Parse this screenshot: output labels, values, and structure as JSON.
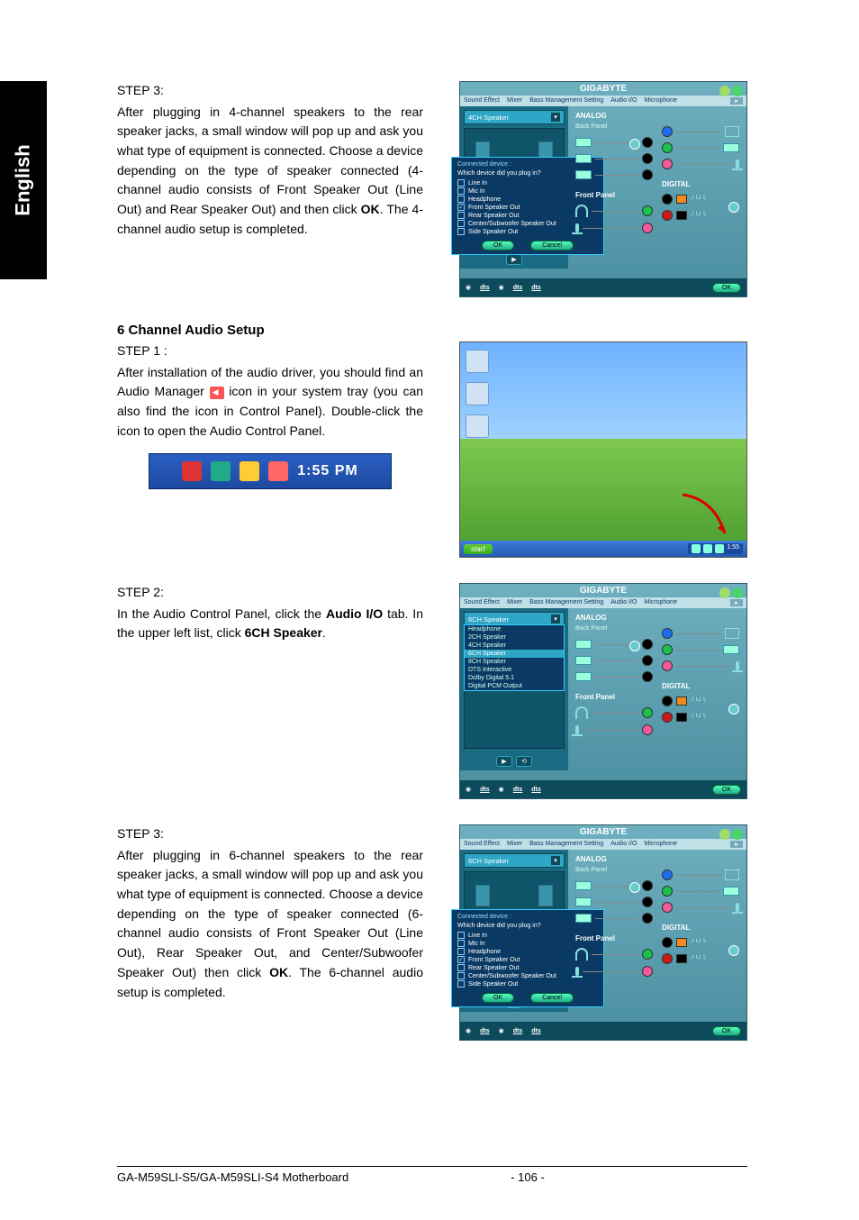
{
  "language_tab": "English",
  "section3a": {
    "step": "STEP 3:",
    "body_a": "After plugging in 4-channel speakers to the rear speaker jacks, a small window will pop up and ask you what type of equipment is connected. Choose a device depending on the type of speaker connected (4-channel audio consists of Front Speaker Out (Line Out) and Rear Speaker Out) and then click ",
    "ok": "OK",
    "body_b": ". The 4-channel audio setup is completed."
  },
  "heading6": "6 Channel Audio Setup",
  "section1b": {
    "step": "STEP 1 :",
    "body_a": "After installation of the audio driver, you should find an Audio Manager",
    "body_b": " icon in your system tray (you can also find the icon in Control Panel).  Double-click the icon to open the Audio Control Panel."
  },
  "tray_time": "1:55 PM",
  "start_label": "start",
  "section2b": {
    "step": "STEP 2:",
    "body_a": "In the Audio Control Panel, click the ",
    "audioio": "Audio I/O",
    "body_b": " tab. In the upper left list, click ",
    "sixch": "6CH Speaker",
    "body_c": "."
  },
  "section3b": {
    "step": "STEP 3:",
    "body_a": "After plugging in 6-channel speakers to the rear speaker jacks, a small window will pop up and ask you what type of equipment is connected. Choose a device depending on the type of speaker connected (6-channel audio consists of Front Speaker Out (Line Out), Rear Speaker Out, and Center/Subwoofer Speaker Out) then click ",
    "ok": "OK",
    "body_b": ". The 6-channel audio setup is completed."
  },
  "panel": {
    "brand": "GIGABYTE",
    "tabs": [
      "Sound Effect",
      "Mixer",
      "Bass Management Setting",
      "Audio I/O",
      "Microphone"
    ],
    "analog": "ANALOG",
    "backpanel": "Back Panel",
    "frontpanel": "Front Panel",
    "digital": "DIGITAL",
    "ok": "OK",
    "dts": "dts",
    "drop_4ch": "4CH Speaker",
    "drop_6ch": "6CH Speaker",
    "droplist": [
      "Headphone",
      "2CH Speaker",
      "4CH Speaker",
      "6CH Speaker",
      "8CH Speaker",
      "DTS Interactive",
      "Dolby Digital 5.1",
      "Digital PCM Output"
    ]
  },
  "popup": {
    "hdr": "Connected device :",
    "q": "Which device did you plug in?",
    "opts": [
      "Line In",
      "Mic In",
      "Headphone",
      "Front Speaker Out",
      "Rear Speaker Out",
      "Center/Subwoofer Speaker Out",
      "Side Speaker Out"
    ],
    "ok": "OK",
    "cancel": "Cancel"
  },
  "footer": {
    "product": "GA-M59SLI-S5/GA-M59SLI-S4 Motherboard",
    "page": "- 106 -"
  }
}
